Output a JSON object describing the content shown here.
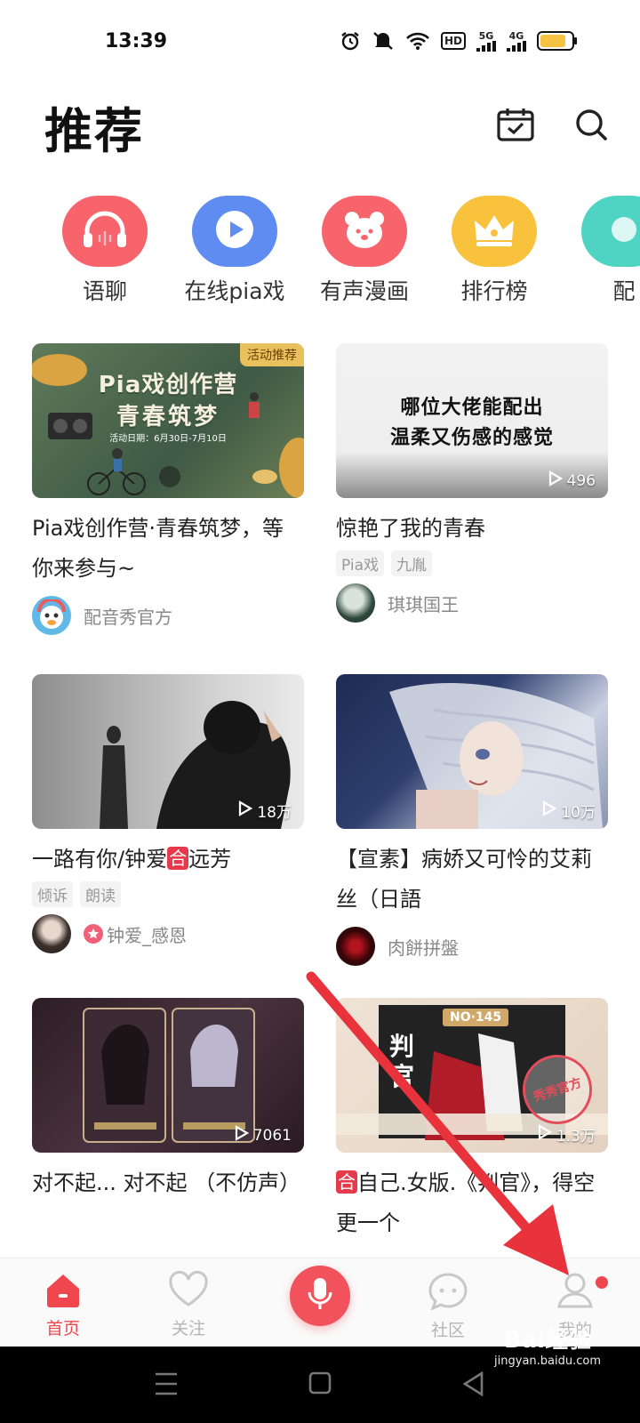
{
  "status_bar": {
    "time": "13:39",
    "net_a": "5G",
    "net_b": "4G",
    "hd": "HD"
  },
  "header": {
    "title": "推荐"
  },
  "categories": [
    {
      "label": "语聊",
      "icon": "headphones-icon",
      "color": "#f7646c"
    },
    {
      "label": "在线pia戏",
      "icon": "play-icon",
      "color": "#5e8cf0"
    },
    {
      "label": "有声漫画",
      "icon": "bear-icon",
      "color": "#f7646c"
    },
    {
      "label": "排行榜",
      "icon": "crown-icon",
      "color": "#f9c23c"
    },
    {
      "label": "配",
      "icon": "dub-icon",
      "color": "#4fd4c4"
    }
  ],
  "cards": [
    {
      "title": "Pia戏创作营·青春筑梦，等你来参与~",
      "corner_tag": "活动推荐",
      "poster_line1": "Pia戏创作营",
      "poster_line2": "青春筑梦",
      "poster_date": "活动日期：6月30日-7月10日",
      "author": "配音秀官方"
    },
    {
      "title": "惊艳了我的青春",
      "poster_line1": "哪位大佬能配出",
      "poster_line2": "温柔又伤感的感觉",
      "plays": "496",
      "tags": [
        "Pia戏",
        "九胤"
      ],
      "author": "琪琪国王"
    },
    {
      "title_pre": "一路有你/钟爱",
      "title_tag": "合",
      "title_post": "远芳",
      "plays": "18万",
      "tags": [
        "倾诉",
        "朗读"
      ],
      "author": "钟爱_感恩"
    },
    {
      "title": "【宣素】病娇又可怜的艾莉丝（日語",
      "plays": "10万",
      "author": "肉餅拼盤"
    },
    {
      "title": "对不起... 对不起 （不仿声）",
      "plays": "7061"
    },
    {
      "title_tag": "合",
      "title_post": "自己.女版.《判官》，得空更一个",
      "plays": "1.3万",
      "poster_no": "NO·145",
      "poster_name": "判官",
      "poster_seal": "秀秀官方"
    }
  ],
  "tab_bar": {
    "home": "首页",
    "follow": "关注",
    "community": "社区",
    "mine": "我的"
  },
  "watermark": {
    "brand": "Bai经验",
    "url": "jingyan.baidu.com"
  },
  "colors": {
    "accent": "#f0474f",
    "annotation_arrow": "#e8323c"
  }
}
